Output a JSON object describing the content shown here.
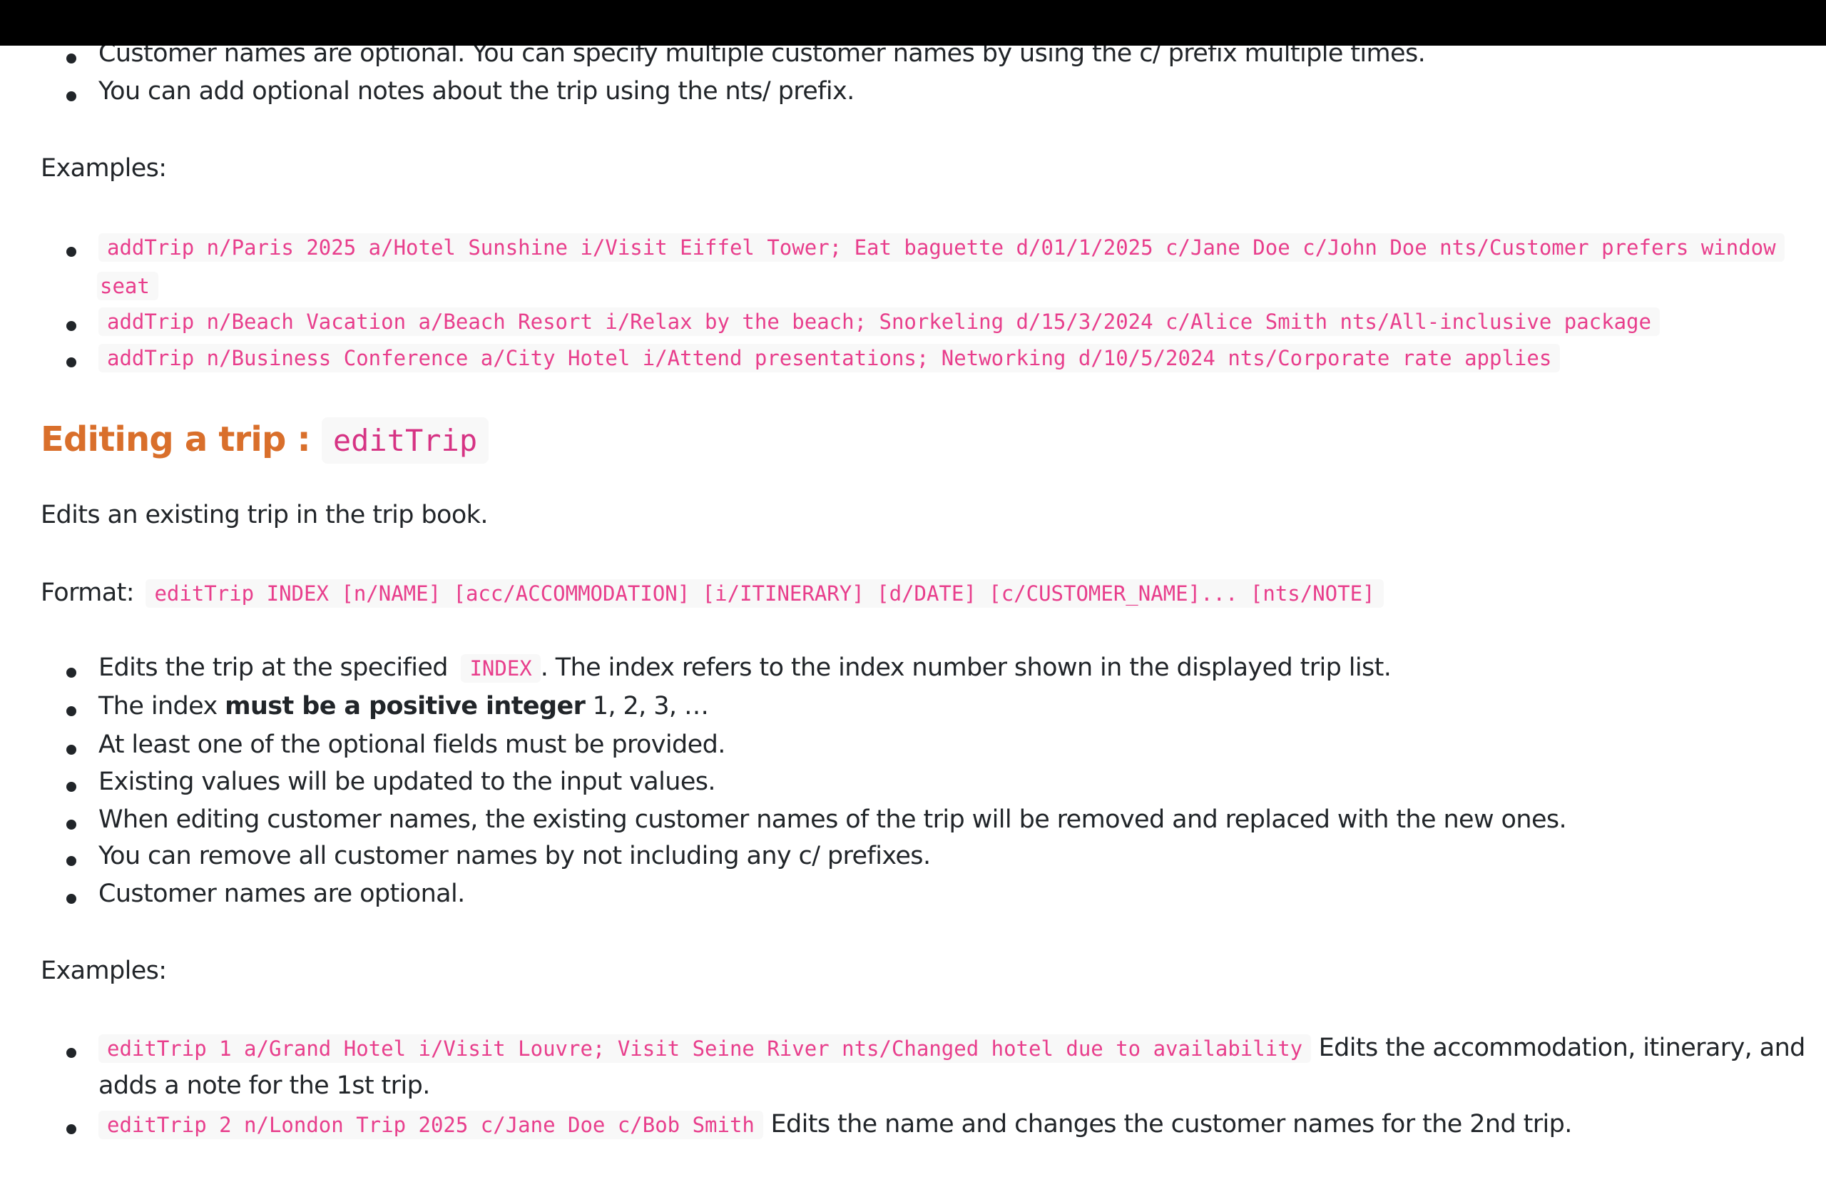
{
  "intro_bullets": [
    "Customer names are optional. You can specify multiple customer names by using the c/ prefix multiple times.",
    "You can add optional notes about the trip using the nts/ prefix."
  ],
  "examples_label_1": "Examples:",
  "add_examples": {
    "ex1_line1": "addTrip n/Paris 2025 a/Hotel Sunshine i/Visit Eiffel Tower; Eat baguette d/01/1/2025 c/Jane Doe c/John Doe nts/Customer prefers window",
    "ex1_line2": "seat",
    "ex2": "addTrip n/Beach Vacation a/Beach Resort i/Relax by the beach; Snorkeling d/15/3/2024 c/Alice Smith nts/All-inclusive package",
    "ex3": "addTrip n/Business Conference a/City Hotel i/Attend presentations; Networking d/10/5/2024 nts/Corporate rate applies"
  },
  "edit_section": {
    "heading_text": "Editing a trip :",
    "heading_code": "editTrip",
    "description": "Edits an existing trip in the trip book.",
    "format_label": "Format:",
    "format_code": "editTrip INDEX [n/NAME] [acc/ACCOMMODATION] [i/ITINERARY] [d/DATE] [c/CUSTOMER_NAME]... [nts/NOTE]",
    "bullet1_before": "Edits the trip at the specified",
    "bullet1_code": "INDEX",
    "bullet1_after": ". The index refers to the index number shown in the displayed trip list.",
    "bullet2_before": "The index",
    "bullet2_bold": "must be a positive integer",
    "bullet2_after": "1, 2, 3, …",
    "bullet3": "At least one of the optional fields must be provided.",
    "bullet4": "Existing values will be updated to the input values.",
    "bullet5": "When editing customer names, the existing customer names of the trip will be removed and replaced with the new ones.",
    "bullet6": "You can remove all customer names by not including any c/ prefixes.",
    "bullet7": "Customer names are optional.",
    "examples_label": "Examples:",
    "ex1_code": "editTrip 1 a/Grand Hotel i/Visit Louvre; Visit Seine River nts/Changed hotel due to availability",
    "ex1_text_line1": "Edits the accommodation, itinerary, and",
    "ex1_text_line2": "adds a note for the 1st trip.",
    "ex2_code": "editTrip 2 n/London Trip 2025 c/Jane Doe c/Bob Smith",
    "ex2_text": "Edits the name and changes the customer names for the 2nd trip."
  }
}
